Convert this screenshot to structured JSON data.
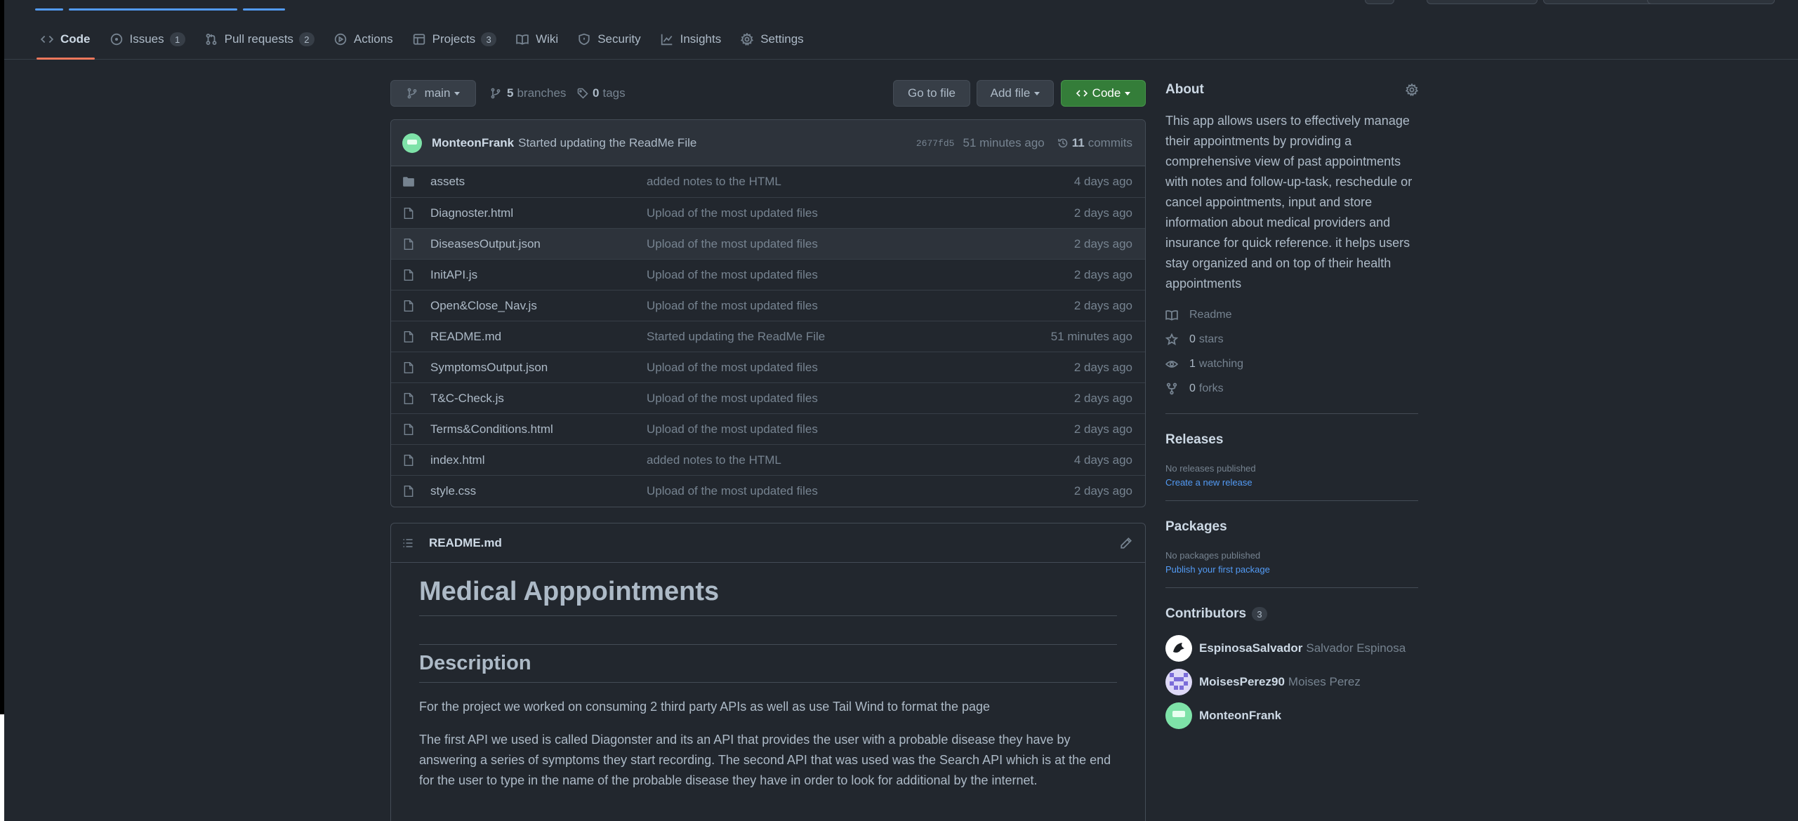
{
  "nav": {
    "tabs": [
      {
        "label": "Code",
        "icon": "code-icon",
        "active": true
      },
      {
        "label": "Issues",
        "icon": "issue-icon",
        "count": "1"
      },
      {
        "label": "Pull requests",
        "icon": "pull-request-icon",
        "count": "2"
      },
      {
        "label": "Actions",
        "icon": "play-icon"
      },
      {
        "label": "Projects",
        "icon": "table-icon",
        "count": "3"
      },
      {
        "label": "Wiki",
        "icon": "book-icon"
      },
      {
        "label": "Security",
        "icon": "shield-icon"
      },
      {
        "label": "Insights",
        "icon": "graph-icon"
      },
      {
        "label": "Settings",
        "icon": "gear-icon"
      }
    ]
  },
  "branch_bar": {
    "branch": "main",
    "branches_count": "5",
    "branches_label": "branches",
    "tags_count": "0",
    "tags_label": "tags",
    "go_to_file": "Go to file",
    "add_file": "Add file",
    "code": "Code"
  },
  "latest_commit": {
    "author": "MonteonFrank",
    "message": "Started updating the ReadMe File",
    "sha": "2677fd5",
    "age": "51 minutes ago",
    "commits_count": "11",
    "commits_label": "commits"
  },
  "files": [
    {
      "name": "assets",
      "type": "folder",
      "message": "added notes to the HTML",
      "age": "4 days ago"
    },
    {
      "name": "Diagnoster.html",
      "type": "file",
      "message": "Upload of the most updated files",
      "age": "2 days ago"
    },
    {
      "name": "DiseasesOutput.json",
      "type": "file",
      "message": "Upload of the most updated files",
      "age": "2 days ago"
    },
    {
      "name": "InitAPI.js",
      "type": "file",
      "message": "Upload of the most updated files",
      "age": "2 days ago"
    },
    {
      "name": "Open&Close_Nav.js",
      "type": "file",
      "message": "Upload of the most updated files",
      "age": "2 days ago"
    },
    {
      "name": "README.md",
      "type": "file",
      "message": "Started updating the ReadMe File",
      "age": "51 minutes ago"
    },
    {
      "name": "SymptomsOutput.json",
      "type": "file",
      "message": "Upload of the most updated files",
      "age": "2 days ago"
    },
    {
      "name": "T&C-Check.js",
      "type": "file",
      "message": "Upload of the most updated files",
      "age": "2 days ago"
    },
    {
      "name": "Terms&Conditions.html",
      "type": "file",
      "message": "Upload of the most updated files",
      "age": "2 days ago"
    },
    {
      "name": "index.html",
      "type": "file",
      "message": "added notes to the HTML",
      "age": "4 days ago"
    },
    {
      "name": "style.css",
      "type": "file",
      "message": "Upload of the most updated files",
      "age": "2 days ago"
    }
  ],
  "readme": {
    "filename": "README.md",
    "h1": "Medical Apppointments",
    "h2": "Description",
    "p1": "For the project we worked on consuming 2 third party APIs as well as use Tail Wind to format the page",
    "p2": "The first API we used is called Diagonster and its an API that provides the user with a probable disease they have by answering a series of symptoms they start recording. The second API that was used was the Search API which is at the end for the user to type in the name of the probable disease they have in order to look for additional by the internet."
  },
  "about": {
    "title": "About",
    "description": "This app allows users to effectively manage their appointments by providing a comprehensive view of past appointments with notes and follow-up-task, reschedule or cancel appointments, input and store information about medical providers and insurance for quick reference. it helps users stay organized and on top of their health appointments",
    "readme": "Readme",
    "stars_count": "0",
    "stars_label": "stars",
    "watching_count": "1",
    "watching_label": "watching",
    "forks_count": "0",
    "forks_label": "forks"
  },
  "releases": {
    "title": "Releases",
    "empty": "No releases published",
    "link": "Create a new release"
  },
  "packages": {
    "title": "Packages",
    "empty": "No packages published",
    "link": "Publish your first package"
  },
  "contributors": {
    "title": "Contributors",
    "count": "3",
    "people": [
      {
        "login": "EspinosaSalvador",
        "name": "Salvador Espinosa"
      },
      {
        "login": "MoisesPerez90",
        "name": "Moises Perez"
      },
      {
        "login": "MonteonFrank",
        "name": ""
      }
    ]
  },
  "colors": {
    "background": "#22272e",
    "accent_tab": "#ec775c",
    "link": "#539bf5",
    "green_button": "#347d39"
  }
}
